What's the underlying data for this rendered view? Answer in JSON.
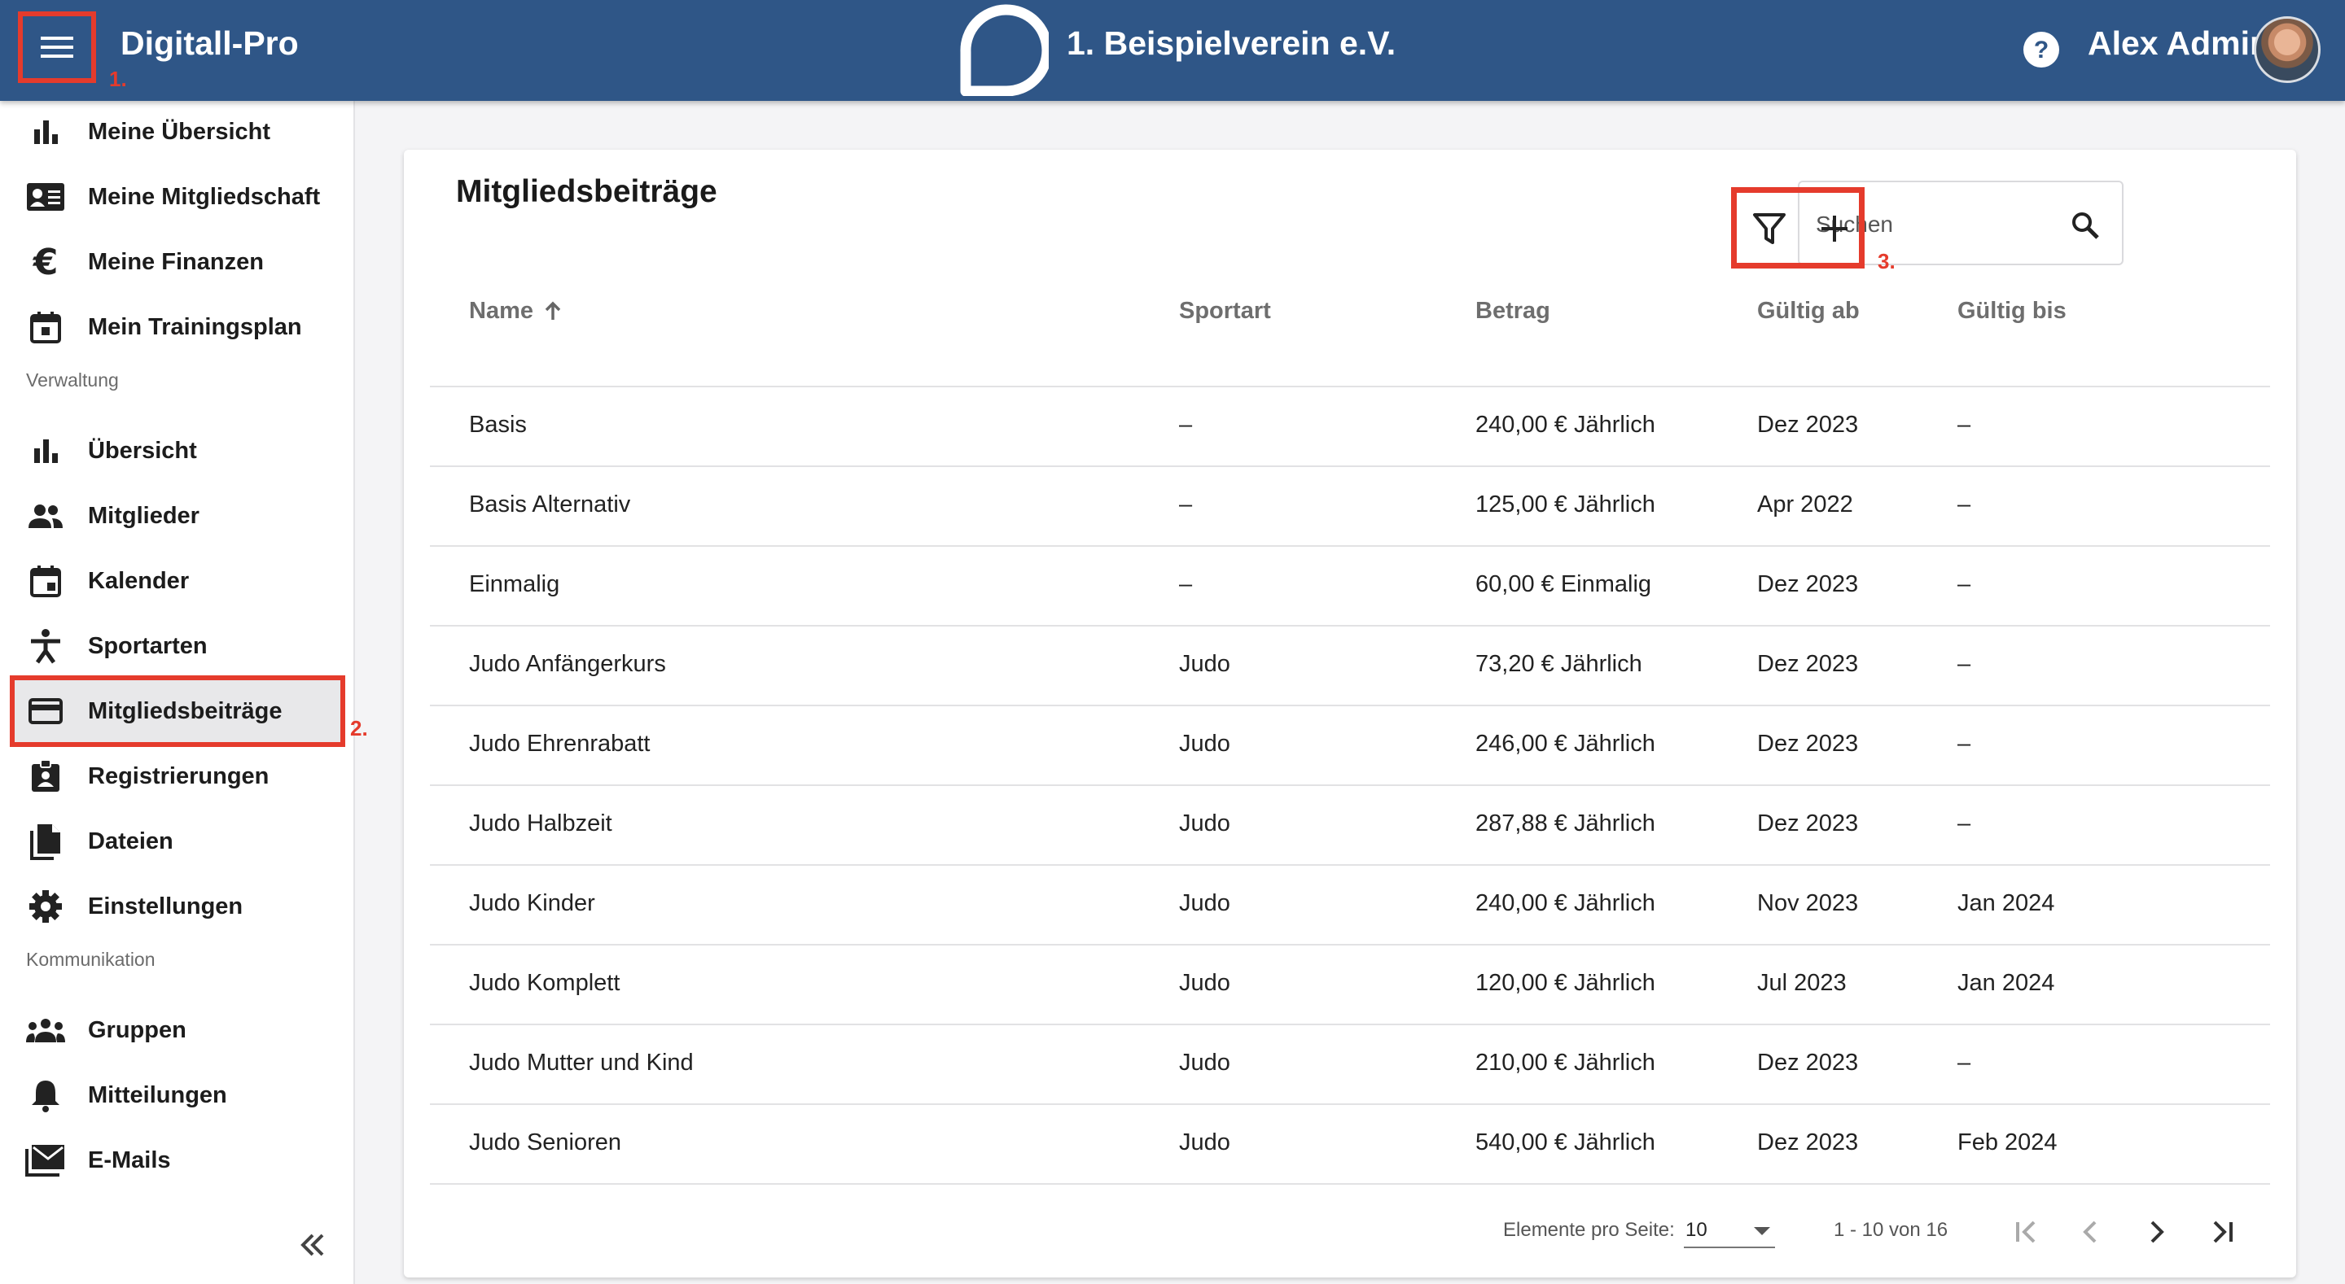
{
  "header": {
    "app_title": "Digitall-Pro",
    "club_name": "1. Beispielverein e.V.",
    "user_name": "Alex Admin",
    "marker_1": "1."
  },
  "sidebar": {
    "top_items": [
      {
        "label": "Meine Übersicht",
        "icon": "bar-chart-icon"
      },
      {
        "label": "Meine Mitgliedschaft",
        "icon": "id-card-icon"
      },
      {
        "label": "Meine Finanzen",
        "icon": "euro-icon"
      },
      {
        "label": "Mein Trainingsplan",
        "icon": "calendar-icon"
      }
    ],
    "section_admin": "Verwaltung",
    "admin_items": [
      {
        "label": "Übersicht",
        "icon": "bar-chart-icon"
      },
      {
        "label": "Mitglieder",
        "icon": "people-icon"
      },
      {
        "label": "Kalender",
        "icon": "calendar-icon"
      },
      {
        "label": "Sportarten",
        "icon": "sport-icon"
      },
      {
        "label": "Mitgliedsbeiträge",
        "icon": "credit-card-icon"
      },
      {
        "label": "Registrierungen",
        "icon": "badge-icon"
      },
      {
        "label": "Dateien",
        "icon": "files-icon"
      },
      {
        "label": "Einstellungen",
        "icon": "gear-icon"
      }
    ],
    "section_comm": "Kommunikation",
    "comm_items": [
      {
        "label": "Gruppen",
        "icon": "groups-icon"
      },
      {
        "label": "Mitteilungen",
        "icon": "bell-icon"
      },
      {
        "label": "E-Mails",
        "icon": "mail-icon"
      }
    ],
    "marker_2": "2."
  },
  "main": {
    "title": "Mitgliedsbeiträge",
    "search_placeholder": "Suchen",
    "marker_3": "3.",
    "columns": [
      "Name",
      "Sportart",
      "Betrag",
      "Gültig ab",
      "Gültig bis"
    ],
    "rows": [
      [
        "Basis",
        "–",
        "240,00 € Jährlich",
        "Dez 2023",
        "–"
      ],
      [
        "Basis Alternativ",
        "–",
        "125,00 € Jährlich",
        "Apr 2022",
        "–"
      ],
      [
        "Einmalig",
        "–",
        "60,00 € Einmalig",
        "Dez 2023",
        "–"
      ],
      [
        "Judo Anfängerkurs",
        "Judo",
        "73,20 € Jährlich",
        "Dez 2023",
        "–"
      ],
      [
        "Judo Ehrenrabatt",
        "Judo",
        "246,00 € Jährlich",
        "Dez 2023",
        "–"
      ],
      [
        "Judo Halbzeit",
        "Judo",
        "287,88 € Jährlich",
        "Dez 2023",
        "–"
      ],
      [
        "Judo Kinder",
        "Judo",
        "240,00 € Jährlich",
        "Nov 2023",
        "Jan 2024"
      ],
      [
        "Judo Komplett",
        "Judo",
        "120,00 € Jährlich",
        "Jul 2023",
        "Jan 2024"
      ],
      [
        "Judo Mutter und Kind",
        "Judo",
        "210,00 € Jährlich",
        "Dez 2023",
        "–"
      ],
      [
        "Judo Senioren",
        "Judo",
        "540,00 € Jährlich",
        "Dez 2023",
        "Feb 2024"
      ]
    ],
    "pager": {
      "per_page_label": "Elemente pro Seite:",
      "per_page_value": "10",
      "range": "1 - 10 von 16"
    }
  },
  "colors": {
    "header_bg": "#2f5687",
    "highlight": "#e53b2c"
  }
}
